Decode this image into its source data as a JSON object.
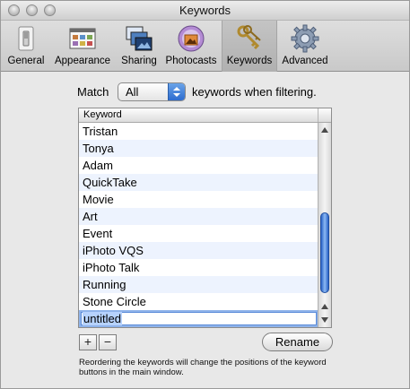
{
  "window": {
    "title": "Keywords"
  },
  "toolbar": {
    "items": [
      {
        "label": "General",
        "icon": "light-switch-icon"
      },
      {
        "label": "Appearance",
        "icon": "appearance-window-icon"
      },
      {
        "label": "Sharing",
        "icon": "sharing-photos-icon"
      },
      {
        "label": "Photocasts",
        "icon": "photocast-icon"
      },
      {
        "label": "Keywords",
        "icon": "keys-icon",
        "selected": true
      },
      {
        "label": "Advanced",
        "icon": "gear-icon"
      }
    ]
  },
  "match": {
    "prefix": "Match",
    "selected_option": "All",
    "suffix": "keywords when filtering."
  },
  "table": {
    "header": "Keyword",
    "rows": [
      "Tristan",
      "Tonya",
      "Adam",
      "QuickTake",
      "Movie",
      "Art",
      "Event",
      "iPhoto VQS",
      "iPhoto Talk",
      "Running",
      "Stone Circle"
    ],
    "editing_value": "untitled"
  },
  "buttons": {
    "add": "+",
    "remove": "−",
    "rename": "Rename"
  },
  "note": "Reordering the keywords will change the positions of the keyword buttons in the main window.",
  "colors": {
    "selection_highlight": "#b6d2fd",
    "alt_row": "#edf3fe",
    "accent_blue": "#2d6ccf"
  }
}
